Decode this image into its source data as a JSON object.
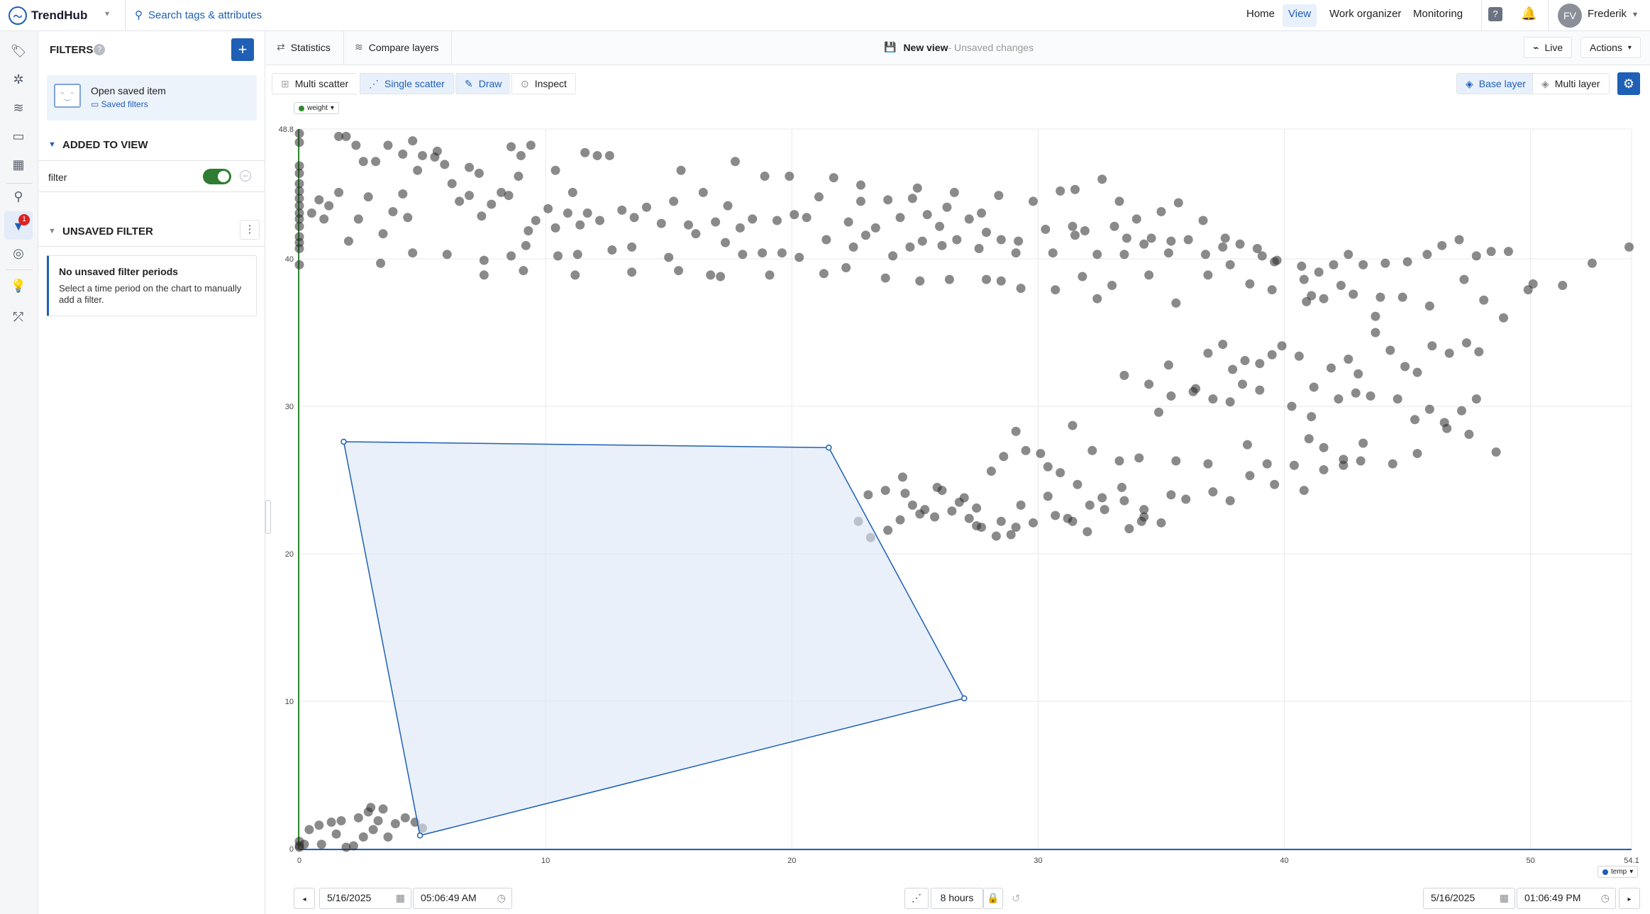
{
  "app": {
    "name": "TrendHub",
    "search_placeholder": "Search tags & attributes"
  },
  "nav": {
    "home": "Home",
    "view": "View",
    "work_organizer": "Work organizer",
    "monitoring": "Monitoring",
    "user_initials": "FV",
    "user_name": "Frederik"
  },
  "rail": {
    "filter_badge": "1"
  },
  "filters": {
    "title": "FILTERS",
    "add_label": "+",
    "open_saved": "Open saved item",
    "saved_filters": "Saved filters",
    "added_to_view": "ADDED TO VIEW",
    "filter_name": "filter",
    "filter_enabled": true,
    "unsaved_filter": "UNSAVED FILTER",
    "no_periods_title": "No unsaved filter periods",
    "no_periods_text": "Select a time period on the chart to manually add a filter."
  },
  "toolbar": {
    "statistics": "Statistics",
    "compare_layers": "Compare layers",
    "view_name": "New view",
    "view_status": " - Unsaved changes",
    "live": "Live",
    "actions": "Actions",
    "multi_scatter": "Multi scatter",
    "single_scatter": "Single scatter",
    "draw": "Draw",
    "inspect": "Inspect",
    "base_layer": "Base layer",
    "multi_layer": "Multi layer"
  },
  "bottom": {
    "start_date": "5/16/2025",
    "start_time": "05:06:49 AM",
    "duration": "8 hours",
    "end_date": "5/16/2025",
    "end_time": "01:06:49 PM"
  },
  "colors": {
    "accent": "#1f5fb5",
    "y_axis": "#2e8b2e",
    "x_axis": "#1f5fb5",
    "points": "#2a2a2a",
    "selection_fill": "#dbe6f5"
  },
  "chart_data": {
    "type": "scatter",
    "x_series": "temp",
    "y_series": "weight",
    "xlim": [
      0,
      54.1
    ],
    "ylim": [
      0,
      48.8
    ],
    "xticks": [
      "0",
      "10",
      "20",
      "30",
      "40",
      "50",
      "54.1"
    ],
    "yticks": [
      "0",
      "10",
      "20",
      "30",
      "40",
      "48.8"
    ],
    "grid": true,
    "polygon_selection": [
      [
        1.8,
        27.6
      ],
      [
        21.5,
        27.2
      ],
      [
        27.0,
        10.2
      ],
      [
        4.9,
        0.9
      ]
    ],
    "points": [
      [
        0,
        48.5
      ],
      [
        0,
        47.9
      ],
      [
        0,
        46.3
      ],
      [
        0,
        45.8
      ],
      [
        0,
        45.1
      ],
      [
        0,
        44.6
      ],
      [
        0,
        44.1
      ],
      [
        0,
        43.6
      ],
      [
        0,
        43.1
      ],
      [
        0,
        42.7
      ],
      [
        0,
        42.2
      ],
      [
        0,
        41.5
      ],
      [
        0,
        41.1
      ],
      [
        0,
        40.7
      ],
      [
        0,
        39.6
      ],
      [
        0.5,
        43.1
      ],
      [
        0.8,
        44.0
      ],
      [
        1.0,
        42.7
      ],
      [
        1.2,
        43.6
      ],
      [
        1.6,
        48.3
      ],
      [
        1.9,
        48.3
      ],
      [
        1.6,
        44.5
      ],
      [
        2.6,
        46.6
      ],
      [
        2.8,
        44.2
      ],
      [
        3.1,
        46.6
      ],
      [
        2.4,
        42.7
      ],
      [
        3.4,
        41.7
      ],
      [
        3.8,
        43.2
      ],
      [
        4.2,
        44.4
      ],
      [
        4.4,
        42.8
      ],
      [
        4.8,
        46.0
      ],
      [
        5.5,
        46.9
      ],
      [
        5.9,
        46.4
      ],
      [
        6.2,
        45.1
      ],
      [
        6.5,
        43.9
      ],
      [
        6.9,
        44.3
      ],
      [
        7.4,
        42.9
      ],
      [
        7.8,
        43.7
      ],
      [
        8.2,
        44.5
      ],
      [
        8.5,
        44.3
      ],
      [
        8.9,
        45.6
      ],
      [
        9.3,
        41.9
      ],
      [
        9.6,
        42.6
      ],
      [
        10.1,
        43.4
      ],
      [
        10.4,
        42.1
      ],
      [
        10.9,
        43.1
      ],
      [
        11.4,
        42.3
      ],
      [
        11.7,
        43.1
      ],
      [
        12.2,
        42.6
      ],
      [
        12.6,
        47.0
      ],
      [
        13.1,
        43.3
      ],
      [
        13.6,
        42.8
      ],
      [
        14.1,
        43.5
      ],
      [
        14.7,
        42.4
      ],
      [
        15.2,
        43.9
      ],
      [
        15.8,
        42.3
      ],
      [
        16.4,
        44.5
      ],
      [
        16.9,
        42.5
      ],
      [
        17.4,
        43.6
      ],
      [
        17.9,
        42.1
      ],
      [
        18.4,
        42.7
      ],
      [
        18.9,
        45.6
      ],
      [
        19.4,
        42.6
      ],
      [
        20.1,
        43.0
      ],
      [
        20.6,
        42.8
      ],
      [
        21.1,
        44.2
      ],
      [
        21.7,
        45.5
      ],
      [
        22.3,
        42.5
      ],
      [
        22.8,
        43.9
      ],
      [
        23.4,
        42.1
      ],
      [
        23.9,
        44.0
      ],
      [
        24.4,
        42.8
      ],
      [
        25.1,
        44.8
      ],
      [
        25.5,
        43.0
      ],
      [
        26.0,
        42.2
      ],
      [
        26.6,
        44.5
      ],
      [
        27.2,
        42.7
      ],
      [
        27.9,
        41.8
      ],
      [
        28.4,
        44.3
      ],
      [
        29.2,
        41.2
      ],
      [
        29.8,
        43.9
      ],
      [
        30.3,
        42.0
      ],
      [
        30.9,
        44.6
      ],
      [
        31.4,
        42.2
      ],
      [
        31.9,
        41.9
      ],
      [
        32.6,
        45.4
      ],
      [
        33.1,
        42.2
      ],
      [
        33.5,
        40.3
      ],
      [
        34.0,
        42.7
      ],
      [
        34.6,
        41.4
      ],
      [
        35.0,
        43.2
      ],
      [
        35.4,
        41.2
      ],
      [
        2.0,
        41.2
      ],
      [
        3.3,
        39.7
      ],
      [
        4.6,
        40.4
      ],
      [
        6.0,
        40.3
      ],
      [
        7.5,
        39.9
      ],
      [
        8.6,
        40.2
      ],
      [
        9.2,
        40.9
      ],
      [
        10.5,
        40.2
      ],
      [
        11.3,
        40.3
      ],
      [
        12.7,
        40.6
      ],
      [
        13.5,
        40.8
      ],
      [
        15.0,
        40.1
      ],
      [
        16.1,
        41.7
      ],
      [
        17.3,
        41.1
      ],
      [
        18.0,
        40.3
      ],
      [
        18.8,
        40.4
      ],
      [
        19.6,
        40.4
      ],
      [
        20.3,
        40.1
      ],
      [
        21.4,
        41.3
      ],
      [
        22.5,
        40.8
      ],
      [
        23.0,
        41.6
      ],
      [
        24.1,
        40.2
      ],
      [
        24.8,
        40.8
      ],
      [
        25.3,
        41.2
      ],
      [
        26.1,
        40.9
      ],
      [
        26.7,
        41.3
      ],
      [
        27.6,
        40.7
      ],
      [
        28.5,
        41.3
      ],
      [
        29.1,
        40.4
      ],
      [
        30.6,
        40.4
      ],
      [
        31.5,
        41.6
      ],
      [
        32.4,
        40.3
      ],
      [
        33.6,
        41.4
      ],
      [
        34.3,
        41.0
      ],
      [
        35.3,
        40.4
      ],
      [
        36.1,
        41.3
      ],
      [
        36.8,
        40.3
      ],
      [
        37.5,
        40.8
      ],
      [
        38.2,
        41.0
      ],
      [
        39.1,
        40.2
      ],
      [
        39.6,
        39.8
      ],
      [
        40.7,
        39.5
      ],
      [
        41.4,
        39.1
      ],
      [
        42.0,
        39.6
      ],
      [
        42.6,
        40.3
      ],
      [
        43.2,
        39.6
      ],
      [
        44.1,
        39.7
      ],
      [
        45.0,
        39.8
      ],
      [
        45.8,
        40.3
      ],
      [
        46.4,
        40.9
      ],
      [
        47.1,
        41.3
      ],
      [
        47.8,
        40.2
      ],
      [
        48.4,
        40.5
      ],
      [
        49.1,
        40.5
      ],
      [
        50.1,
        38.3
      ],
      [
        51.3,
        38.2
      ],
      [
        52.5,
        39.7
      ],
      [
        54.0,
        40.8
      ],
      [
        7.5,
        38.9
      ],
      [
        9.1,
        39.2
      ],
      [
        11.2,
        38.9
      ],
      [
        13.5,
        39.1
      ],
      [
        15.4,
        39.2
      ],
      [
        16.7,
        38.9
      ],
      [
        17.1,
        38.8
      ],
      [
        19.1,
        38.9
      ],
      [
        21.3,
        39.0
      ],
      [
        22.2,
        39.4
      ],
      [
        23.8,
        38.7
      ],
      [
        25.2,
        38.5
      ],
      [
        26.4,
        38.6
      ],
      [
        27.9,
        38.6
      ],
      [
        28.5,
        38.5
      ],
      [
        29.3,
        38.0
      ],
      [
        30.7,
        37.9
      ],
      [
        31.8,
        38.8
      ],
      [
        32.4,
        37.3
      ],
      [
        33.0,
        38.2
      ],
      [
        34.5,
        38.9
      ],
      [
        35.6,
        37.0
      ],
      [
        36.9,
        38.9
      ],
      [
        37.8,
        39.6
      ],
      [
        38.6,
        38.3
      ],
      [
        39.5,
        37.9
      ],
      [
        40.9,
        37.1
      ],
      [
        41.6,
        37.3
      ],
      [
        42.8,
        37.6
      ],
      [
        43.7,
        36.1
      ],
      [
        44.8,
        37.4
      ],
      [
        45.9,
        36.8
      ],
      [
        47.3,
        38.6
      ],
      [
        48.1,
        37.2
      ],
      [
        48.9,
        36.0
      ],
      [
        49.9,
        37.9
      ],
      [
        33.5,
        32.1
      ],
      [
        34.5,
        31.5
      ],
      [
        35.3,
        32.8
      ],
      [
        36.4,
        31.2
      ],
      [
        36.9,
        33.6
      ],
      [
        37.5,
        34.2
      ],
      [
        37.9,
        32.5
      ],
      [
        38.4,
        33.1
      ],
      [
        39.0,
        32.9
      ],
      [
        39.5,
        33.5
      ],
      [
        39.9,
        34.1
      ],
      [
        40.6,
        33.4
      ],
      [
        41.2,
        31.3
      ],
      [
        41.9,
        32.6
      ],
      [
        42.6,
        33.2
      ],
      [
        43.0,
        32.2
      ],
      [
        43.7,
        35.0
      ],
      [
        44.3,
        33.8
      ],
      [
        44.9,
        32.7
      ],
      [
        45.4,
        32.3
      ],
      [
        46.0,
        34.1
      ],
      [
        46.7,
        33.6
      ],
      [
        47.4,
        34.3
      ],
      [
        47.9,
        33.7
      ],
      [
        34.9,
        29.6
      ],
      [
        35.4,
        30.7
      ],
      [
        36.3,
        31.0
      ],
      [
        37.1,
        30.5
      ],
      [
        37.8,
        30.3
      ],
      [
        38.3,
        31.5
      ],
      [
        39.0,
        31.1
      ],
      [
        40.3,
        30.0
      ],
      [
        41.1,
        29.3
      ],
      [
        42.2,
        30.5
      ],
      [
        42.9,
        30.9
      ],
      [
        43.5,
        30.7
      ],
      [
        44.6,
        30.5
      ],
      [
        45.3,
        29.1
      ],
      [
        45.9,
        29.8
      ],
      [
        46.5,
        28.9
      ],
      [
        47.2,
        29.7
      ],
      [
        47.8,
        30.5
      ],
      [
        12.1,
        47.0
      ],
      [
        15.5,
        46.0
      ],
      [
        17.7,
        46.6
      ],
      [
        19.9,
        45.6
      ],
      [
        22.8,
        45.0
      ],
      [
        24.9,
        44.1
      ],
      [
        26.3,
        43.5
      ],
      [
        27.7,
        43.1
      ],
      [
        31.5,
        44.7
      ],
      [
        33.3,
        43.9
      ],
      [
        35.7,
        43.8
      ],
      [
        36.7,
        42.6
      ],
      [
        37.6,
        41.4
      ],
      [
        38.9,
        40.7
      ],
      [
        39.7,
        39.9
      ],
      [
        40.8,
        38.6
      ],
      [
        41.1,
        37.5
      ],
      [
        42.3,
        38.2
      ],
      [
        43.9,
        37.4
      ],
      [
        8.6,
        47.6
      ],
      [
        9.0,
        47.0
      ],
      [
        10.4,
        46.0
      ],
      [
        11.1,
        44.5
      ],
      [
        11.6,
        47.2
      ],
      [
        5.0,
        47.0
      ],
      [
        5.6,
        47.3
      ],
      [
        6.9,
        46.2
      ],
      [
        7.3,
        45.8
      ],
      [
        9.4,
        47.7
      ],
      [
        2.3,
        47.7
      ],
      [
        3.6,
        47.7
      ],
      [
        4.2,
        47.1
      ],
      [
        4.6,
        48.0
      ],
      [
        31.4,
        28.7
      ],
      [
        32.2,
        27.0
      ],
      [
        33.3,
        26.3
      ],
      [
        34.1,
        26.5
      ],
      [
        35.6,
        26.3
      ],
      [
        36.9,
        26.1
      ],
      [
        38.5,
        27.4
      ],
      [
        39.3,
        26.1
      ],
      [
        40.4,
        26.0
      ],
      [
        41.0,
        27.8
      ],
      [
        41.6,
        27.2
      ],
      [
        42.4,
        26.4
      ],
      [
        43.2,
        27.5
      ],
      [
        44.4,
        26.1
      ],
      [
        45.4,
        26.8
      ],
      [
        46.6,
        28.5
      ],
      [
        47.5,
        28.1
      ],
      [
        48.6,
        26.9
      ],
      [
        27.5,
        23.1
      ],
      [
        28.1,
        25.6
      ],
      [
        28.6,
        26.6
      ],
      [
        29.1,
        28.3
      ],
      [
        29.5,
        27.0
      ],
      [
        30.1,
        26.8
      ],
      [
        30.4,
        25.9
      ],
      [
        30.9,
        25.5
      ],
      [
        31.6,
        24.7
      ],
      [
        32.6,
        23.8
      ],
      [
        33.4,
        24.5
      ],
      [
        34.2,
        22.2
      ],
      [
        35.0,
        22.1
      ],
      [
        36.0,
        23.7
      ],
      [
        37.1,
        24.2
      ],
      [
        37.8,
        23.6
      ],
      [
        38.6,
        25.3
      ],
      [
        39.6,
        24.7
      ],
      [
        40.8,
        24.3
      ],
      [
        41.6,
        25.7
      ],
      [
        42.4,
        26.0
      ],
      [
        43.1,
        26.3
      ],
      [
        24.4,
        22.3
      ],
      [
        24.9,
        23.3
      ],
      [
        25.8,
        22.5
      ],
      [
        26.5,
        22.9
      ],
      [
        27.2,
        22.4
      ],
      [
        28.5,
        22.2
      ],
      [
        29.1,
        21.8
      ],
      [
        29.8,
        22.1
      ],
      [
        30.7,
        22.6
      ],
      [
        31.4,
        22.2
      ],
      [
        32.1,
        23.3
      ],
      [
        32.7,
        23.0
      ],
      [
        33.5,
        23.6
      ],
      [
        34.3,
        22.5
      ],
      [
        35.4,
        24.0
      ],
      [
        22.7,
        22.2
      ],
      [
        23.1,
        24.0
      ],
      [
        23.8,
        24.3
      ],
      [
        24.6,
        24.1
      ],
      [
        25.4,
        23.0
      ],
      [
        25.9,
        24.5
      ],
      [
        26.8,
        23.5
      ],
      [
        27.7,
        21.8
      ],
      [
        28.3,
        21.2
      ],
      [
        29.3,
        23.3
      ],
      [
        30.4,
        23.9
      ],
      [
        31.2,
        22.4
      ],
      [
        32.0,
        21.5
      ],
      [
        33.7,
        21.7
      ],
      [
        34.3,
        23.0
      ],
      [
        23.2,
        21.1
      ],
      [
        23.9,
        21.6
      ],
      [
        24.5,
        25.2
      ],
      [
        25.2,
        22.7
      ],
      [
        26.1,
        24.3
      ],
      [
        27.0,
        23.8
      ],
      [
        27.5,
        21.9
      ],
      [
        28.9,
        21.3
      ],
      [
        0,
        0.2
      ],
      [
        0,
        0.5
      ],
      [
        0,
        0.1
      ],
      [
        0.2,
        0.3
      ],
      [
        0.4,
        1.3
      ],
      [
        0.8,
        1.6
      ],
      [
        1.3,
        1.8
      ],
      [
        1.7,
        1.9
      ],
      [
        2.2,
        0.2
      ],
      [
        2.6,
        0.8
      ],
      [
        3.0,
        1.3
      ],
      [
        3.6,
        0.8
      ],
      [
        2.4,
        2.1
      ],
      [
        3.2,
        1.9
      ],
      [
        3.9,
        1.7
      ],
      [
        4.3,
        2.1
      ],
      [
        4.7,
        1.8
      ],
      [
        5.0,
        1.4
      ],
      [
        2.8,
        2.5
      ],
      [
        3.4,
        2.7
      ],
      [
        1.5,
        1.0
      ],
      [
        0.9,
        0.3
      ],
      [
        1.9,
        0.1
      ],
      [
        2.9,
        2.8
      ]
    ]
  }
}
